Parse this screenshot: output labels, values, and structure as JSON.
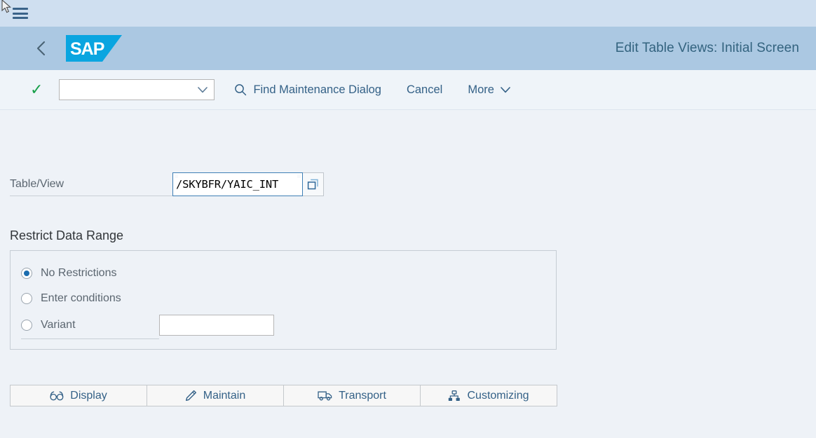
{
  "shell": {
    "menu_icon": "hamburger-menu-icon",
    "cursor": "mouse-pointer"
  },
  "header": {
    "back_icon": "back-chevron-icon",
    "logo_text": "SAP",
    "title": "Edit Table Views: Initial Screen"
  },
  "toolbar": {
    "confirm_icon": "green-checkmark-icon",
    "dropdown_value": "",
    "dropdown_icon": "chevron-down-icon",
    "find_icon": "search-icon",
    "find_label": "Find Maintenance Dialog",
    "cancel_label": "Cancel",
    "more_label": "More",
    "more_icon": "chevron-down-icon"
  },
  "form": {
    "table_view_label": "Table/View",
    "table_view_value": "/SKYBFR/YAIC_INT",
    "table_view_placeholder": "",
    "copy_icon": "copy-duplicate-icon"
  },
  "restrict": {
    "section_title": "Restrict Data Range",
    "options": [
      {
        "label": "No Restrictions",
        "selected": true
      },
      {
        "label": "Enter conditions",
        "selected": false
      },
      {
        "label": "Variant",
        "selected": false
      }
    ],
    "variant_value": "",
    "variant_placeholder": ""
  },
  "actions": [
    {
      "label": "Display",
      "icon": "glasses-icon"
    },
    {
      "label": "Maintain",
      "icon": "pencil-icon"
    },
    {
      "label": "Transport",
      "icon": "truck-icon"
    },
    {
      "label": "Customizing",
      "icon": "org-chart-icon"
    }
  ],
  "colors": {
    "shellbar_bg": "#cfdff0",
    "header_bg": "#abc8e2",
    "toolbar_bg": "#eff4f9",
    "page_bg": "#eef2f7",
    "accent_link": "#346187",
    "sap_blue": "#0aa5e0",
    "confirm_green": "#18a04a",
    "radio_selected": "#1b6daf"
  }
}
